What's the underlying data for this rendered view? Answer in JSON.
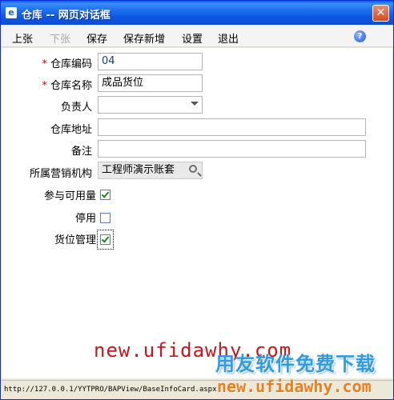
{
  "window": {
    "title": "仓库 -- 网页对话框",
    "icon": "ie-page-icon",
    "close_glyph": "✕"
  },
  "menu": {
    "items": [
      {
        "label": "上张",
        "enabled": true
      },
      {
        "label": "下张",
        "enabled": false
      },
      {
        "label": "保存",
        "enabled": true
      },
      {
        "label": "保存新增",
        "enabled": true
      },
      {
        "label": "设置",
        "enabled": true
      },
      {
        "label": "退出",
        "enabled": true
      }
    ],
    "help_glyph": "?"
  },
  "form": {
    "warehouse_code": {
      "label": "仓库编码",
      "required": true,
      "value": "04"
    },
    "warehouse_name": {
      "label": "仓库名称",
      "required": true,
      "value": "成品货位"
    },
    "owner": {
      "label": "负责人",
      "value": ""
    },
    "address": {
      "label": "仓库地址",
      "value": ""
    },
    "remark": {
      "label": "备注",
      "value": ""
    },
    "sales_org": {
      "label": "所属营销机构",
      "value": "工程师演示账套"
    },
    "available": {
      "label": "参与可用量",
      "checked": true
    },
    "disabled": {
      "label": "停用",
      "checked": false
    },
    "location_mgmt": {
      "label": "货位管理",
      "checked": true
    }
  },
  "required_mark": "*",
  "watermark": {
    "url": "new.ufidawhy.com",
    "cn": "用友软件免费下载",
    "url2": "new.ufidawhy.com"
  },
  "status": {
    "text": "http://127.0.0.1/YYTPRO/BAPView/BaseInfoCard.aspx"
  },
  "colors": {
    "title_bar": "#0a56e0",
    "required": "#dd0000",
    "check": "#1a8a1a"
  }
}
